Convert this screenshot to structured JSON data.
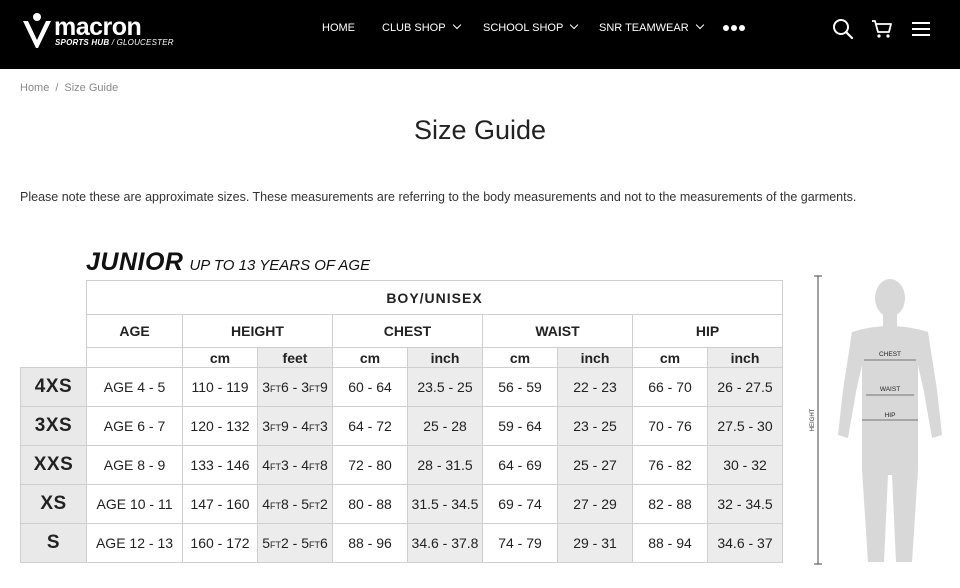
{
  "header": {
    "logo_word": "macron",
    "logo_sub_bold": "SPORTS HUB",
    "logo_sub_rest": " / GLOUCESTER",
    "nav": [
      {
        "label": "HOME",
        "has_dropdown": false
      },
      {
        "label": "CLUB SHOP",
        "has_dropdown": true
      },
      {
        "label": "SCHOOL SHOP",
        "has_dropdown": true
      },
      {
        "label": "SNR TEAMWEAR",
        "has_dropdown": true
      }
    ],
    "icons": [
      "more-dots-icon",
      "search-icon",
      "cart-icon",
      "menu-icon"
    ]
  },
  "breadcrumb": {
    "home": "Home",
    "separator": "/",
    "current": "Size Guide"
  },
  "page_title": "Size Guide",
  "note": "Please note these are approximate sizes. These measurements are referring to the body measurements and not to the measurements of the garments.",
  "chart": {
    "title": "JUNIOR",
    "subtitle": "UP TO 13 YEARS OF AGE",
    "group_header": "BOY/UNISEX",
    "columns": {
      "age": "AGE",
      "height": "HEIGHT",
      "chest": "CHEST",
      "waist": "WAIST",
      "hip": "HIP"
    },
    "units": {
      "cm": "cm",
      "feet": "feet",
      "inch": "inch"
    },
    "rows": [
      {
        "size": "4XS",
        "age": "AGE 4 - 5",
        "height_cm": "110 - 119",
        "h_ft": [
          "3",
          "FT",
          "6 - 3",
          "FT",
          "9"
        ],
        "chest_cm": "60 - 64",
        "chest_in": "23.5 - 25",
        "waist_cm": "56 - 59",
        "waist_in": "22 - 23",
        "hip_cm": "66 - 70",
        "hip_in": "26 - 27.5"
      },
      {
        "size": "3XS",
        "age": "AGE 6 - 7",
        "height_cm": "120 - 132",
        "h_ft": [
          "3",
          "FT",
          "9 - 4",
          "FT",
          "3"
        ],
        "chest_cm": "64 - 72",
        "chest_in": "25 - 28",
        "waist_cm": "59 - 64",
        "waist_in": "23 - 25",
        "hip_cm": "70 - 76",
        "hip_in": "27.5 - 30"
      },
      {
        "size": "XXS",
        "age": "AGE 8 - 9",
        "height_cm": "133 - 146",
        "h_ft": [
          "4",
          "FT",
          "3 - 4",
          "FT",
          "8"
        ],
        "chest_cm": "72 - 80",
        "chest_in": "28 - 31.5",
        "waist_cm": "64 - 69",
        "waist_in": "25 - 27",
        "hip_cm": "76 - 82",
        "hip_in": "30 - 32"
      },
      {
        "size": "XS",
        "age": "AGE 10 - 11",
        "height_cm": "147 - 160",
        "h_ft": [
          "4",
          "FT",
          "8 - 5",
          "FT",
          "2"
        ],
        "chest_cm": "80 - 88",
        "chest_in": "31.5 - 34.5",
        "waist_cm": "69 - 74",
        "waist_in": "27 - 29",
        "hip_cm": "82 - 88",
        "hip_in": "32 - 34.5"
      },
      {
        "size": "S",
        "age": "AGE 12 - 13",
        "height_cm": "160 - 172",
        "h_ft": [
          "5",
          "FT",
          "2 - 5",
          "FT",
          "6"
        ],
        "chest_cm": "88 - 96",
        "chest_in": "34.6 - 37.8",
        "waist_cm": "74 - 79",
        "waist_in": "29 - 31",
        "hip_cm": "88 - 94",
        "hip_in": "34.6 - 37"
      }
    ]
  },
  "figure_labels": {
    "chest": "CHEST",
    "waist": "WAIST",
    "hip": "HIP",
    "height": "HEIGHT"
  }
}
